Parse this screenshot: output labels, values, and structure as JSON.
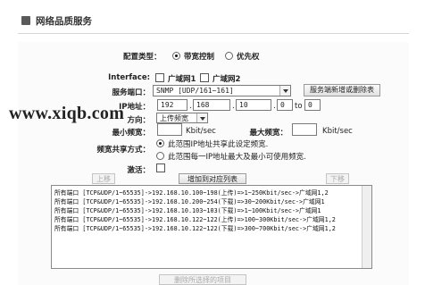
{
  "header": {
    "title": "网络品质服务"
  },
  "config_type": {
    "label": "配置类型：",
    "options": [
      {
        "label": "带宽控制",
        "selected": true
      },
      {
        "label": "优先权",
        "selected": false
      }
    ]
  },
  "interface": {
    "label": "Interface:",
    "options": [
      {
        "label": "广域网1",
        "checked": false
      },
      {
        "label": "广域网2",
        "checked": false
      }
    ]
  },
  "service_port": {
    "label": "服务端口：",
    "value": "SNMP [UDP/161~161]",
    "button_label": "服务端新增或删除表"
  },
  "ip_address": {
    "label": "IP地址：",
    "octets": [
      "192",
      "168",
      "10",
      "0"
    ],
    "to_label": "to",
    "to_value": "0"
  },
  "direction": {
    "label": "方向：",
    "value": "上传频宽"
  },
  "bandwidth": {
    "min_label": "最小频宽：",
    "min_value": "",
    "min_unit": "Kbit/sec",
    "max_label": "最大频宽：",
    "max_value": "",
    "max_unit": "Kbit/sec"
  },
  "sharing": {
    "label": "频宽共享方式：",
    "options": [
      {
        "label": "此范围IP地址共享此设定频宽.",
        "selected": true
      },
      {
        "label": "此范围每一IP地址最大及最小可使用频宽.",
        "selected": false
      }
    ]
  },
  "activate": {
    "label": "激活：",
    "checked": false
  },
  "buttons": {
    "up": "上移",
    "add": "增加到对应列表",
    "down": "下移",
    "delete": "删除所选择的项目"
  },
  "rules": [
    "所有端口 [TCP&UDP/1~65535]->192.168.10.100~198(上传)=>1~250Kbit/sec->广域网1,2",
    "所有端口 [TCP&UDP/1~65535]->192.168.10.200~254(下载)=>30~200Kbit/sec->广域网1",
    "所有端口 [TCP&UDP/1~65535]->192.168.10.103~103(下载)=>1~100Kbit/sec->广域网1",
    "所有端口 [TCP&UDP/1~65535]->192.168.10.122~122(上传)=>100~300Kbit/sec->广域网1,2",
    "所有端口 [TCP&UDP/1~65535]->192.168.10.122~122(下载)=>300~700Kbit/sec->广域网1,2"
  ],
  "watermark": "www.xiqb.com"
}
